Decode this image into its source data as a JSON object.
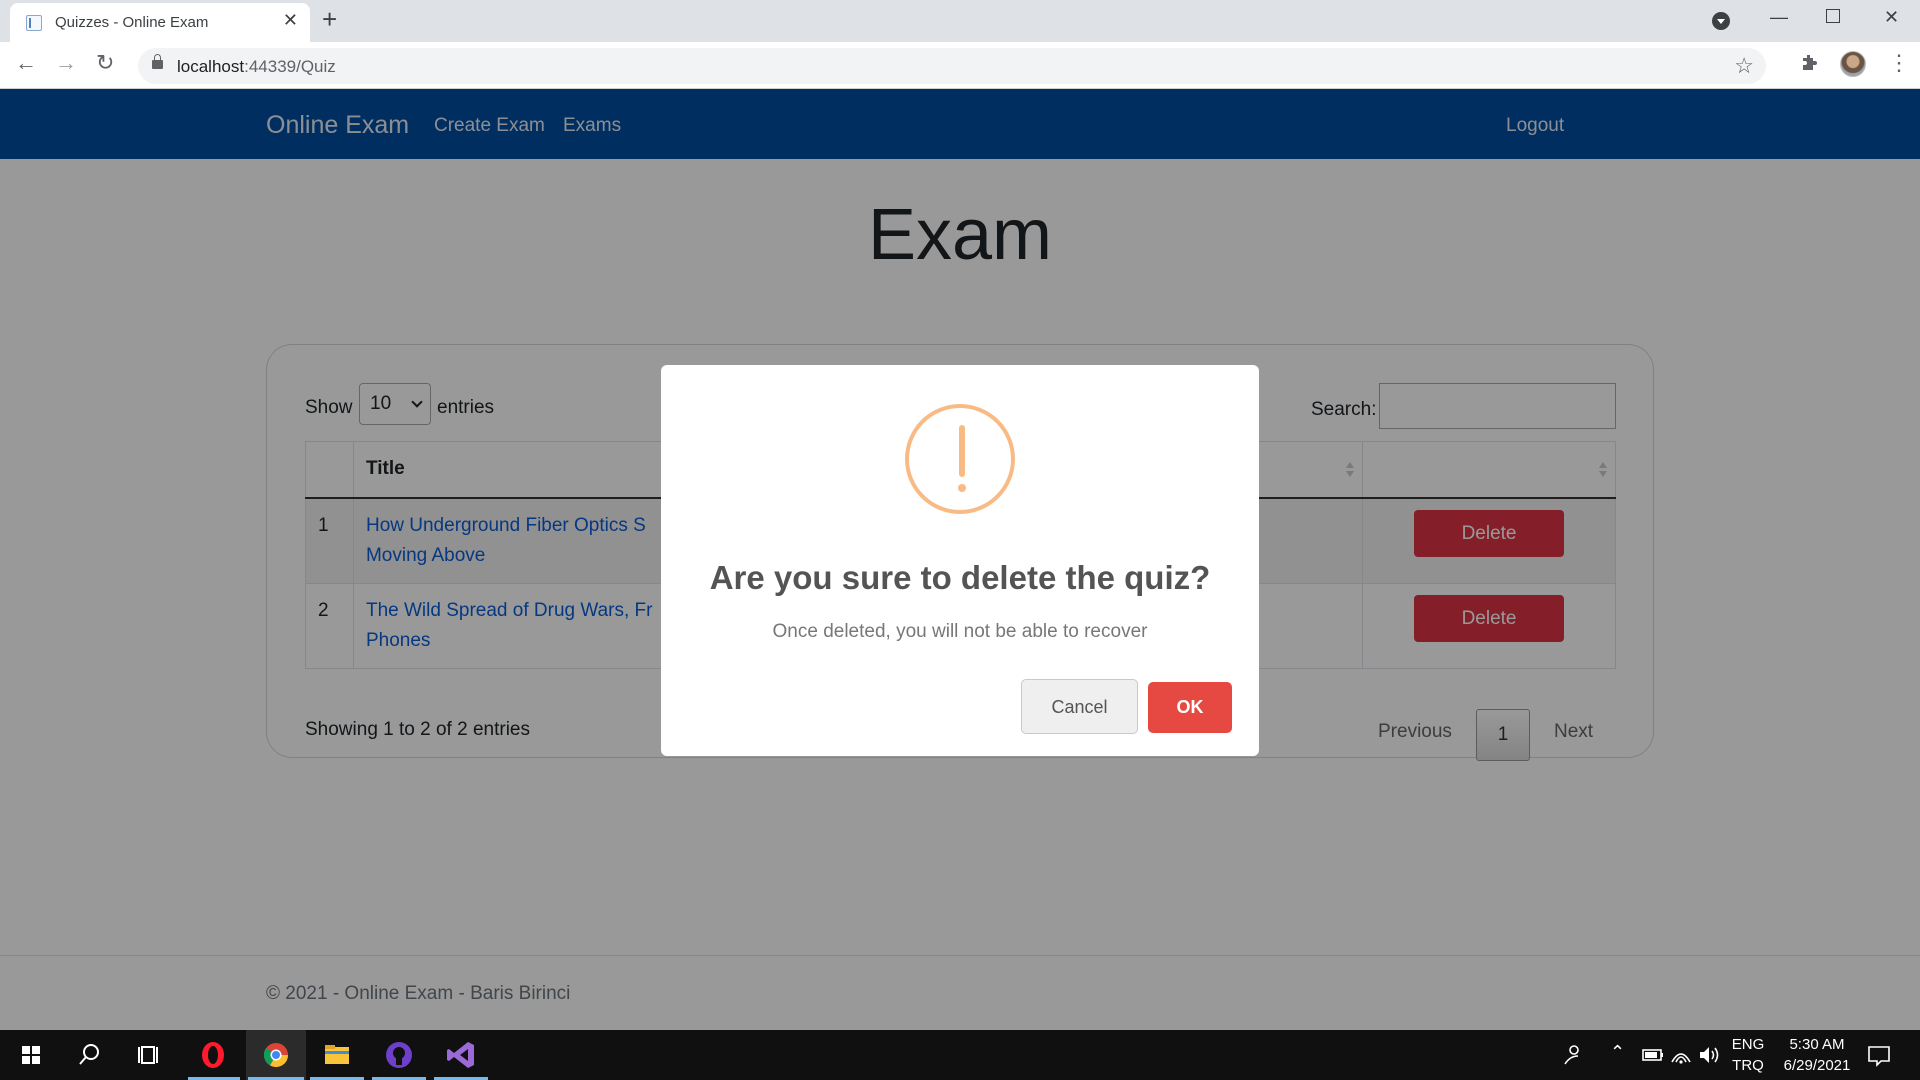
{
  "browser": {
    "tab_title": "Quizzes - Online Exam",
    "url_host": "localhost",
    "url_rest": ":44339/Quiz"
  },
  "navbar": {
    "brand": "Online Exam",
    "links": [
      "Create Exam",
      "Exams"
    ],
    "logout": "Logout",
    "bg_color": "#024ea2"
  },
  "page": {
    "title": "Exam",
    "show_label": "Show",
    "page_length": "10",
    "entries_label": "entries",
    "search_label": "Search:",
    "search_value": "",
    "columns": [
      "",
      "Title",
      "",
      ""
    ],
    "rows": [
      {
        "num": "1",
        "title_visible": "How Underground Fiber Optics S",
        "title_line2": "Moving Above",
        "action": "Delete"
      },
      {
        "num": "2",
        "title_visible": "The Wild Spread of Drug Wars, Fr",
        "title_line2": "Phones",
        "action": "Delete"
      }
    ],
    "info": "Showing 1 to 2 of 2 entries",
    "pagination": {
      "previous": "Previous",
      "current": "1",
      "next": "Next"
    },
    "footer": "© 2021 - Online Exam - Baris Birinci"
  },
  "modal": {
    "icon": "warning-icon",
    "title": "Are you sure to delete the quiz?",
    "text": "Once deleted, you will not be able to recover",
    "cancel_label": "Cancel",
    "ok_label": "OK",
    "accent": "#f8bb86",
    "ok_color": "#e64942"
  },
  "taskbar": {
    "lang_1": "ENG",
    "lang_2": "TRQ",
    "time": "5:30 AM",
    "date": "6/29/2021",
    "apps": [
      "start-icon",
      "search-icon",
      "task-view-icon",
      "opera-icon",
      "chrome-icon",
      "file-explorer-icon",
      "github-desktop-icon",
      "visual-studio-icon"
    ]
  }
}
